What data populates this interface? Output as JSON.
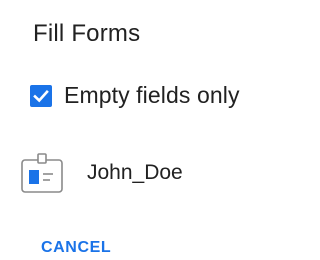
{
  "dialog": {
    "title": "Fill Forms",
    "option": {
      "label": "Empty fields only",
      "checked": true
    },
    "profile": {
      "icon": "id-card-icon",
      "name": "John_Doe"
    },
    "cancel_label": "CANCEL"
  },
  "colors": {
    "accent": "#1a73e8",
    "text": "#212121"
  }
}
